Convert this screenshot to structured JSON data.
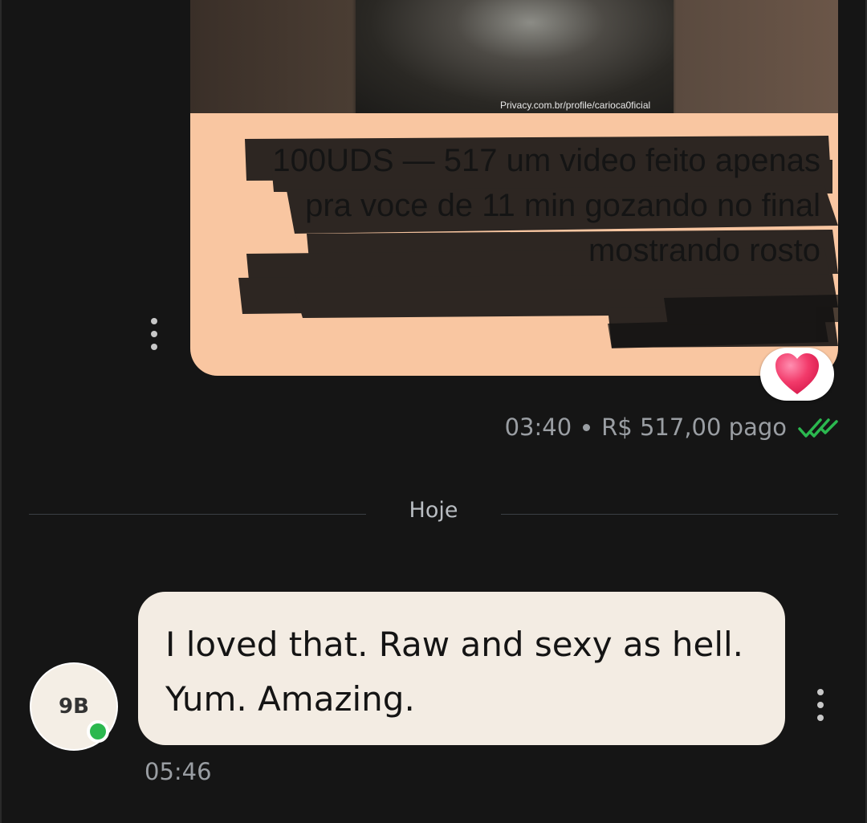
{
  "media_message": {
    "watermark": "Privacy.com.br/profile/carioca0ficial",
    "caption": "100UDS — 517 um video feito apenas pra voce de 11 min gozando no final mostrando rosto",
    "reaction": "❤️",
    "time": "03:40",
    "payment_status": "R$ 517,00 pago",
    "read_icon": "double-check-icon",
    "colors": {
      "bubble": "#f9c6a1",
      "check": "#2bb84f"
    }
  },
  "divider": {
    "label": "Hoje"
  },
  "incoming_message": {
    "avatar_initials": "9B",
    "text": "I loved that. Raw and sexy as hell. Yum. Amazing.",
    "time": "05:46",
    "online": true,
    "colors": {
      "bubble": "#f3ece3",
      "presence": "#2bb84f"
    }
  }
}
